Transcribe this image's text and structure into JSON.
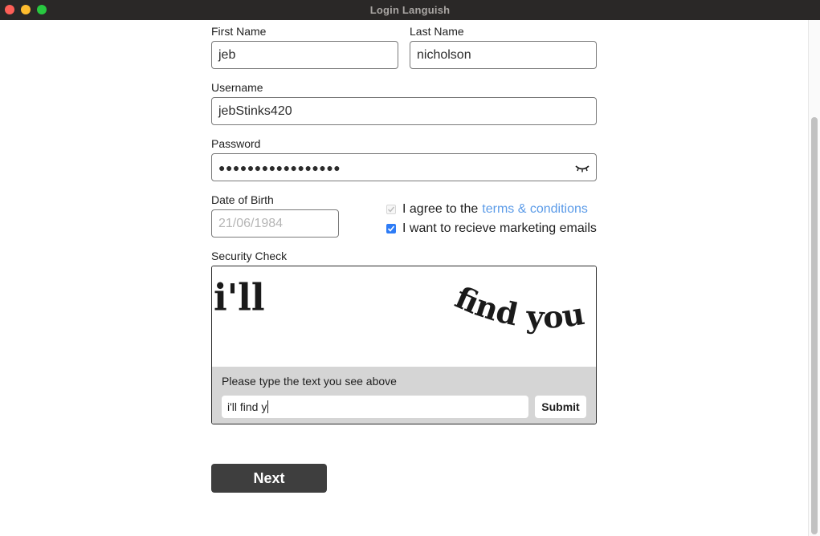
{
  "window": {
    "title": "Login Languish"
  },
  "form": {
    "first_name": {
      "label": "First Name",
      "value": "jeb"
    },
    "last_name": {
      "label": "Last Name",
      "value": "nicholson"
    },
    "username": {
      "label": "Username",
      "value": "jebStinks420"
    },
    "password": {
      "label": "Password",
      "masked_value": "●●●●●●●●●●●●●●●●●"
    },
    "dob": {
      "label": "Date of Birth",
      "placeholder": "21/06/1984"
    },
    "terms": {
      "prefix": "I agree to the",
      "link": "terms & conditions",
      "checked": true,
      "disabled": true
    },
    "marketing": {
      "label": "I want to recieve marketing emails",
      "checked": true
    },
    "security": {
      "label": "Security Check",
      "captcha_word1": "i'll",
      "captcha_word2": "find you",
      "prompt": "Please type the text you see above",
      "input_value": "i'll find y",
      "submit_label": "Submit"
    },
    "next_label": "Next"
  },
  "icons": {
    "password_toggle": "eye-closed-icon"
  },
  "colors": {
    "link": "#5b9be8",
    "checkbox": "#2e7cf6",
    "next_button": "#3e3e3e",
    "captcha_panel": "#d5d5d5"
  }
}
